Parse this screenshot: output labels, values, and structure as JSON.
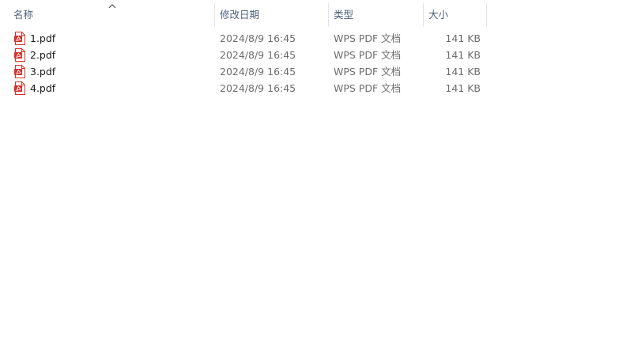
{
  "columns": {
    "name": "名称",
    "modified": "修改日期",
    "type": "类型",
    "size": "大小"
  },
  "sort": {
    "column": "name",
    "direction": "ascending",
    "icon": "chevron-up-icon"
  },
  "files": [
    {
      "name": "1.pdf",
      "modified": "2024/8/9 16:45",
      "type": "WPS PDF 文档",
      "size": "141 KB",
      "icon": "pdf-file-icon"
    },
    {
      "name": "2.pdf",
      "modified": "2024/8/9 16:45",
      "type": "WPS PDF 文档",
      "size": "141 KB",
      "icon": "pdf-file-icon"
    },
    {
      "name": "3.pdf",
      "modified": "2024/8/9 16:45",
      "type": "WPS PDF 文档",
      "size": "141 KB",
      "icon": "pdf-file-icon"
    },
    {
      "name": "4.pdf",
      "modified": "2024/8/9 16:45",
      "type": "WPS PDF 文档",
      "size": "141 KB",
      "icon": "pdf-file-icon"
    }
  ],
  "colors": {
    "header_text": "#4c607a",
    "icon_red": "#d6312a",
    "secondary_text": "#6d6d6d"
  }
}
